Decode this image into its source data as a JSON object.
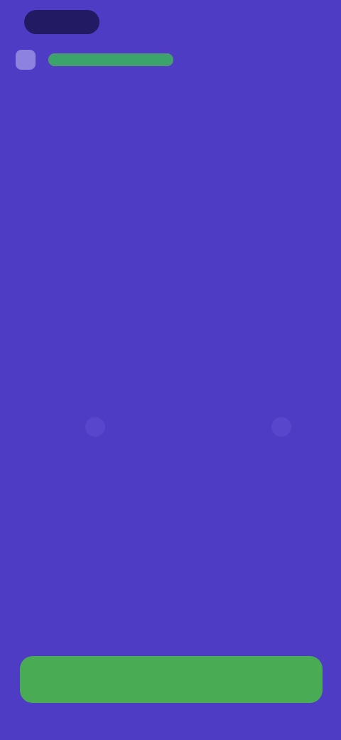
{
  "colors": {
    "background": "#4f3cc4",
    "progress_fill": "#3aa56a",
    "cta_background": "#4aab55",
    "status_pill": "#221a63"
  },
  "header": {
    "back_icon": "back-icon",
    "progress": 1.0
  },
  "main": {
    "headline": "",
    "form_heading": "",
    "fields": [
      "",
      "",
      "",
      ""
    ],
    "choices": [
      "",
      ""
    ],
    "helper_link": "",
    "terms": "",
    "fine_print": ""
  },
  "footer": {
    "cta_label": ""
  }
}
